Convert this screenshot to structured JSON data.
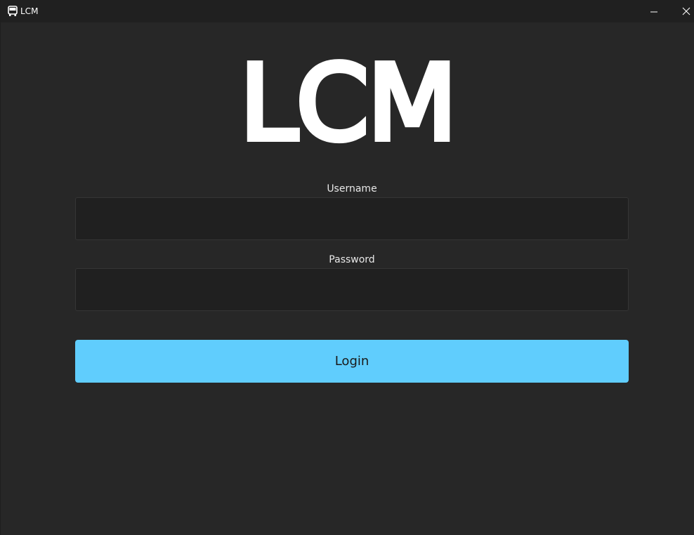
{
  "window": {
    "title": "LCM",
    "app_icon": "bus-icon",
    "controls": {
      "minimize_icon": "minimize-icon",
      "close_icon": "close-icon"
    }
  },
  "logo": {
    "text": "LCM"
  },
  "form": {
    "username_label": "Username",
    "username_value": "",
    "password_label": "Password",
    "password_value": "",
    "login_label": "Login"
  },
  "colors": {
    "background": "#272727",
    "titlebar": "#202020",
    "input_background": "#202020",
    "accent": "#60cdfd",
    "text": "#ffffff"
  }
}
